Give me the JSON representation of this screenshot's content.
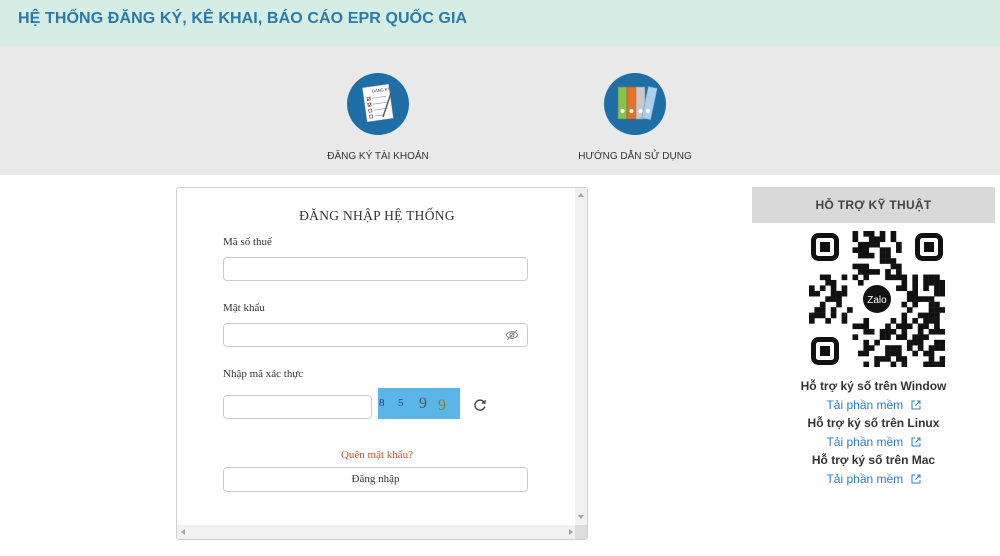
{
  "header": {
    "title": "HỆ THỐNG ĐĂNG KÝ, KÊ KHAI, BÁO CÁO EPR QUỐC GIA"
  },
  "hero": {
    "register": {
      "label": "ĐĂNG KÝ TÀI KHOẢN",
      "icon": "registration-form-icon",
      "doc_caption": "ĐĂNG KÝ"
    },
    "guide": {
      "label": "HƯỚNG DẪN SỬ DỤNG",
      "icon": "binders-icon"
    }
  },
  "login": {
    "heading": "ĐĂNG NHẬP HỆ THỐNG",
    "tax_code_label": "Mã số thuế",
    "tax_code_value": "",
    "password_label": "Mật khẩu",
    "password_value": "",
    "captcha_label": "Nhập mã xác thực",
    "captcha_value": "",
    "captcha_digits": [
      "8",
      "5",
      "9",
      "9"
    ],
    "forgot_label": "Quên mật khẩu?",
    "submit_label": "Đăng nhập"
  },
  "support": {
    "title": "HỖ TRỢ KỸ THUẬT",
    "qr_brand": "Zalo",
    "items": [
      {
        "title": "Hỗ trợ ký số trên Window",
        "link": "Tải phần mềm"
      },
      {
        "title": "Hỗ trợ ký số trên Linux",
        "link": "Tải phần mềm"
      },
      {
        "title": "Hỗ trợ ký số trên Mac",
        "link": "Tải phần mềm"
      }
    ]
  },
  "colors": {
    "header_bg": "#d6ede6",
    "header_text": "#2a79a8",
    "hero_bg": "#e9e9e9",
    "icon_circle": "#1f6fa6",
    "forgot_link": "#c0562b",
    "support_link": "#2a7cc7",
    "captcha_bg": "#5bb6e8"
  }
}
